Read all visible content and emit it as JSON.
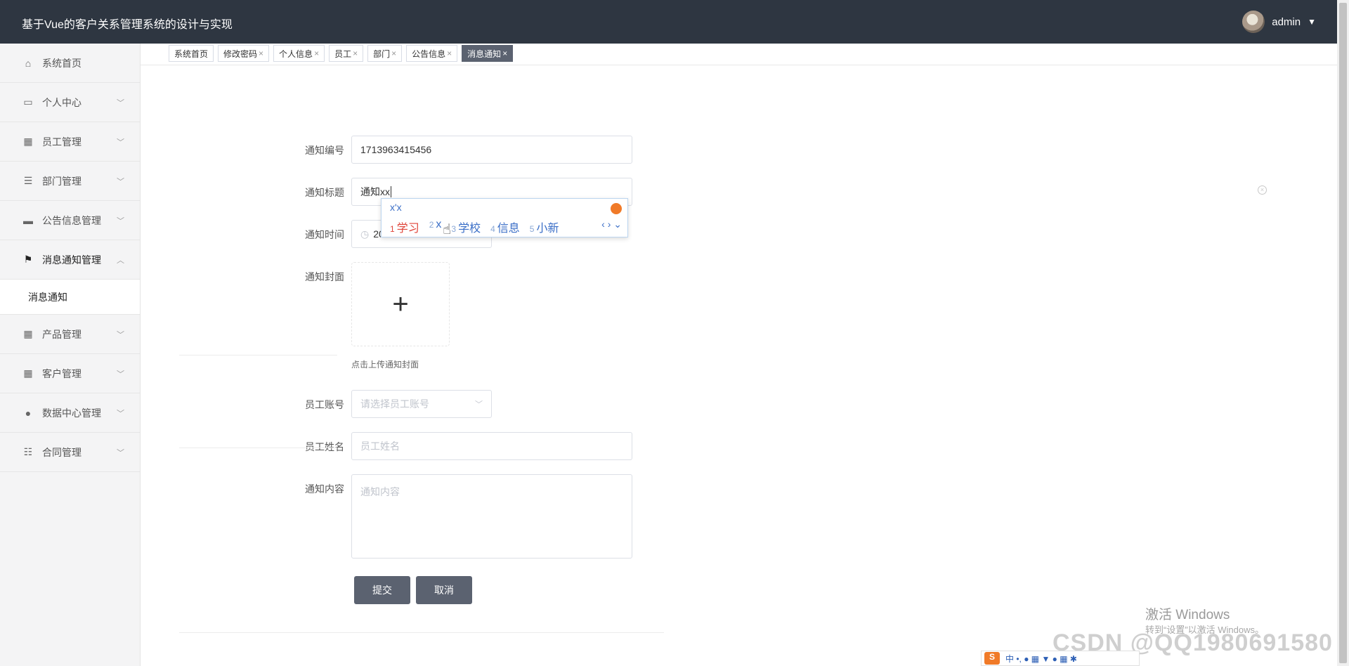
{
  "app": {
    "title": "基于Vue的客户关系管理系统的设计与实现",
    "user": "admin"
  },
  "sidebar": {
    "items": [
      {
        "label": "系统首页",
        "icon": "home-icon",
        "glyph": "⌂"
      },
      {
        "label": "个人中心",
        "icon": "card-icon",
        "glyph": "▭"
      },
      {
        "label": "员工管理",
        "icon": "grid-icon",
        "glyph": "▦"
      },
      {
        "label": "部门管理",
        "icon": "list-icon",
        "glyph": "☰"
      },
      {
        "label": "公告信息管理",
        "icon": "briefcase-icon",
        "glyph": "▬"
      },
      {
        "label": "消息通知管理",
        "icon": "flag-icon",
        "glyph": "⚑"
      },
      {
        "label": "产品管理",
        "icon": "grid-icon",
        "glyph": "▦"
      },
      {
        "label": "客户管理",
        "icon": "apps-icon",
        "glyph": "▦"
      },
      {
        "label": "数据中心管理",
        "icon": "user-icon",
        "glyph": "●"
      },
      {
        "label": "合同管理",
        "icon": "sliders-icon",
        "glyph": "☷"
      }
    ],
    "submenu": {
      "label": "消息通知"
    }
  },
  "tabs": [
    {
      "label": "系统首页",
      "close": ""
    },
    {
      "label": "修改密码",
      "close": "×"
    },
    {
      "label": "个人信息",
      "close": "×"
    },
    {
      "label": "员工",
      "close": "×"
    },
    {
      "label": "部门",
      "close": "×"
    },
    {
      "label": "公告信息",
      "close": "×"
    },
    {
      "label": "消息通知",
      "close": "×"
    }
  ],
  "form": {
    "notice_no": {
      "label": "通知编号",
      "value": "1713963415456"
    },
    "notice_title": {
      "label": "通知标题",
      "value": "通知xx"
    },
    "notice_time": {
      "label": "通知时间",
      "value": "20"
    },
    "notice_cover": {
      "label": "通知封面",
      "hint": "点击上传通知封面"
    },
    "employee_account": {
      "label": "员工账号",
      "placeholder": "请选择员工账号"
    },
    "employee_name": {
      "label": "员工姓名",
      "placeholder": "员工姓名"
    },
    "notice_content": {
      "label": "通知内容",
      "placeholder": "通知内容"
    },
    "submit": "提交",
    "cancel": "取消"
  },
  "ime": {
    "input": "x'x",
    "candidates": [
      {
        "n": "1",
        "text": "学习"
      },
      {
        "n": "2",
        "text": "x"
      },
      {
        "n": "3",
        "text": "学校"
      },
      {
        "n": "4",
        "text": "信息"
      },
      {
        "n": "5",
        "text": "小新"
      }
    ],
    "nav": "‹ › ⌄"
  },
  "overlay": {
    "activate_windows": "激活 Windows",
    "activate_hint": "转到“设置”以激活 Windows。",
    "csdn": "CSDN @QQ1980691580",
    "taskbar_ime": "中 •, ● ▦ ▼ ● ▦ ✱"
  }
}
